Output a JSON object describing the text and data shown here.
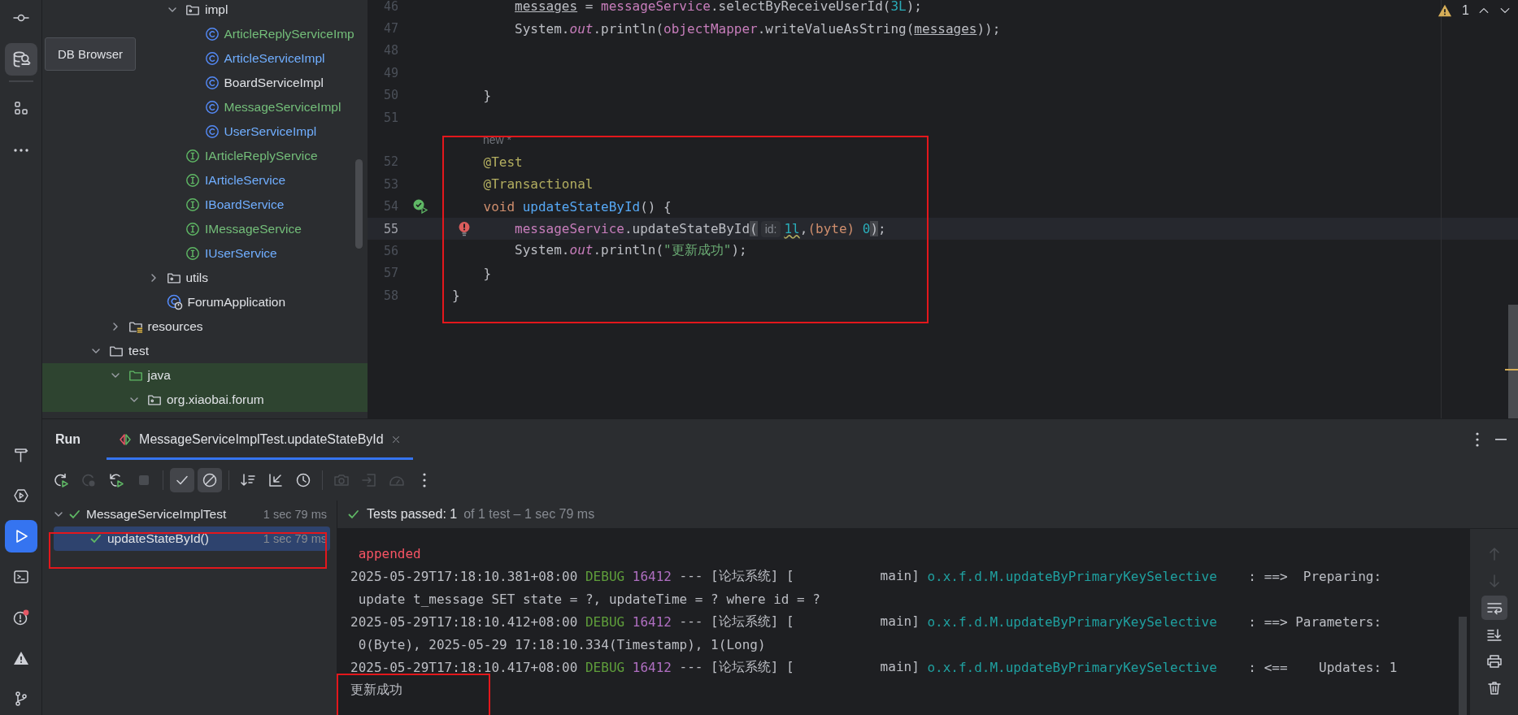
{
  "left_toolbar": {
    "top": [
      {
        "kind": "commit",
        "selected": false
      },
      {
        "kind": "database",
        "selected": true
      },
      {
        "kind": "structure",
        "selected": false
      },
      {
        "kind": "more",
        "selected": false
      }
    ],
    "bottom": [
      {
        "kind": "build",
        "selected": false
      },
      {
        "kind": "services",
        "selected": false
      },
      {
        "kind": "run",
        "selected": true
      },
      {
        "kind": "terminal",
        "selected": false
      },
      {
        "kind": "problems",
        "selected": false,
        "badge": true
      },
      {
        "kind": "warning",
        "selected": false
      },
      {
        "kind": "git",
        "selected": false
      }
    ]
  },
  "tooltip": {
    "text": "DB Browser"
  },
  "project_tree": {
    "items": [
      {
        "children": [
          {
            "children": [
              {
                "children": [
                  {
                    "children": [
                      {
                        "label": "impl",
                        "kind": "package",
                        "color": "#dfe1e5",
                        "expanded": true,
                        "highlighted": false,
                        "children": [
                          {
                            "label": "ArticleReplyServiceImp",
                            "kind": "class",
                            "color": "#73bd79",
                            "highlighted": false
                          },
                          {
                            "label": "ArticleServiceImpl",
                            "kind": "class",
                            "color": "#70aeff",
                            "highlighted": false
                          },
                          {
                            "label": "BoardServiceImpl",
                            "kind": "class",
                            "color": "#dfe1e5",
                            "highlighted": false
                          },
                          {
                            "label": "MessageServiceImpl",
                            "kind": "class",
                            "color": "#73bd79",
                            "highlighted": false
                          },
                          {
                            "label": "UserServiceImpl",
                            "kind": "class",
                            "color": "#70aeff",
                            "highlighted": false
                          }
                        ]
                      },
                      {
                        "label": "IArticleReplyService",
                        "kind": "interface",
                        "color": "#73bd79",
                        "highlighted": false
                      },
                      {
                        "label": "IArticleService",
                        "kind": "interface",
                        "color": "#70aeff",
                        "highlighted": false
                      },
                      {
                        "label": "IBoardService",
                        "kind": "interface",
                        "color": "#70aeff",
                        "highlighted": false
                      },
                      {
                        "label": "IMessageService",
                        "kind": "interface",
                        "color": "#73bd79",
                        "highlighted": false
                      },
                      {
                        "label": "IUserService",
                        "kind": "interface",
                        "color": "#70aeff",
                        "highlighted": false
                      }
                    ]
                  },
                  {
                    "label": "utils",
                    "kind": "package",
                    "color": "#dfe1e5",
                    "expanded": false,
                    "highlighted": false
                  },
                  {
                    "label": "ForumApplication",
                    "kind": "app",
                    "color": "#dfe1e5",
                    "highlighted": false
                  }
                ]
              }
            ]
          },
          {
            "label": "resources",
            "kind": "resources",
            "color": "#dfe1e5",
            "expanded": false,
            "highlighted": false
          }
        ]
      },
      {
        "label": "test",
        "kind": "folder",
        "color": "#dfe1e5",
        "expanded": true,
        "highlighted": false,
        "children": [
          {
            "label": "java",
            "kind": "test-root",
            "color": "#dfe1e5",
            "expanded": true,
            "highlighted": true,
            "children": [
              {
                "label": "org.xiaobai.forum",
                "kind": "package",
                "color": "#dfe1e5",
                "expanded": true,
                "highlighted": true
              }
            ]
          }
        ]
      }
    ]
  },
  "editor": {
    "problems": {
      "count": "1"
    },
    "lines": [
      {
        "kind": "code",
        "number": "46",
        "current": false,
        "tokens": [
          {
            "text": "        messages",
            "kind": "underlined"
          },
          {
            "text": " = ",
            "kind": "plain"
          },
          {
            "text": "messageService",
            "kind": "field"
          },
          {
            "text": ".selectByReceiveUserId(",
            "kind": "plain"
          },
          {
            "text": "3L",
            "kind": "number"
          },
          {
            "text": ");",
            "kind": "plain"
          }
        ]
      },
      {
        "kind": "code",
        "number": "47",
        "current": false,
        "tokens": [
          {
            "text": "        System.",
            "kind": "plain"
          },
          {
            "text": "out",
            "kind": "static"
          },
          {
            "text": ".println(",
            "kind": "plain"
          },
          {
            "text": "objectMapper",
            "kind": "field"
          },
          {
            "text": ".writeValueAsString(",
            "kind": "plain"
          },
          {
            "text": "messages",
            "kind": "underlined"
          },
          {
            "text": "));",
            "kind": "plain"
          }
        ]
      },
      {
        "kind": "code",
        "number": "48",
        "current": false
      },
      {
        "kind": "code",
        "number": "49",
        "current": false
      },
      {
        "kind": "code",
        "number": "50",
        "current": false,
        "tokens": [
          {
            "text": "    }",
            "kind": "plain"
          }
        ]
      },
      {
        "kind": "code",
        "number": "51",
        "current": false
      },
      {
        "kind": "hint",
        "text": "new *"
      },
      {
        "kind": "code",
        "number": "52",
        "current": false,
        "tokens": [
          {
            "text": "    @Test",
            "kind": "annotation"
          }
        ]
      },
      {
        "kind": "code",
        "number": "53",
        "current": false,
        "tokens": [
          {
            "text": "    @Transactional",
            "kind": "annotation"
          }
        ]
      },
      {
        "kind": "code",
        "number": "54",
        "current": false,
        "gutter": {
          "kind": "run-passed"
        },
        "tokens": [
          {
            "text": "    void ",
            "kind": "keyword"
          },
          {
            "text": "updateStateById",
            "kind": "declaration"
          },
          {
            "text": "() {",
            "kind": "plain"
          }
        ]
      },
      {
        "kind": "code",
        "number": "55",
        "current": true,
        "gutter": {
          "kind": "error"
        },
        "tokens": [
          {
            "text": "        messageService",
            "kind": "field"
          },
          {
            "text": ".updateStateById",
            "kind": "plain"
          },
          {
            "text": "(",
            "kind": "bracket"
          },
          {
            "text": "id:",
            "kind": "inlay"
          },
          {
            "text": "1l",
            "kind": "number-warning"
          },
          {
            "text": ",",
            "kind": "plain"
          },
          {
            "text": "(byte) ",
            "kind": "keyword"
          },
          {
            "text": "0",
            "kind": "number"
          },
          {
            "text": ")",
            "kind": "bracket"
          },
          {
            "text": ";",
            "kind": "plain"
          }
        ]
      },
      {
        "kind": "code",
        "number": "56",
        "current": false,
        "tokens": [
          {
            "text": "        System.",
            "kind": "plain"
          },
          {
            "text": "out",
            "kind": "static"
          },
          {
            "text": ".println(",
            "kind": "plain"
          },
          {
            "text": "\"更新成功\"",
            "kind": "string"
          },
          {
            "text": ");",
            "kind": "plain"
          }
        ]
      },
      {
        "kind": "code",
        "number": "57",
        "current": false,
        "tokens": [
          {
            "text": "    }",
            "kind": "plain"
          }
        ]
      },
      {
        "kind": "code",
        "number": "58",
        "current": false,
        "tokens": [
          {
            "text": "}",
            "kind": "plain"
          }
        ]
      }
    ]
  },
  "run": {
    "title": "Run",
    "tabs": [
      {
        "label": "MessageServiceImplTest.updateStateById",
        "selected": true
      }
    ],
    "toolbar": [
      {
        "kind": "rerun",
        "disabled": false
      },
      {
        "kind": "rerun-failed",
        "disabled": true
      },
      {
        "kind": "auto-rerun",
        "disabled": false
      },
      {
        "kind": "stop",
        "disabled": true
      },
      {
        "kind": "separator"
      },
      {
        "kind": "show-passed",
        "disabled": false,
        "on": true
      },
      {
        "kind": "show-ignored",
        "disabled": false,
        "on": true
      },
      {
        "kind": "separator"
      },
      {
        "kind": "sort",
        "disabled": false
      },
      {
        "kind": "collapse",
        "disabled": false
      },
      {
        "kind": "history",
        "disabled": false
      },
      {
        "kind": "separator"
      },
      {
        "kind": "camera",
        "disabled": true
      },
      {
        "kind": "import",
        "disabled": true
      },
      {
        "kind": "gauge",
        "disabled": true
      },
      {
        "kind": "more",
        "disabled": false
      }
    ],
    "tests": [
      {
        "label": "MessageServiceImplTest",
        "time": "1 sec 79 ms",
        "kind": "passed",
        "expanded": true,
        "selected": false,
        "children": [
          {
            "label": "updateStateById()",
            "time": "1 sec 79 ms",
            "kind": "passed",
            "selected": true
          }
        ]
      }
    ],
    "summary": {
      "label": "Tests passed: 1",
      "detail": "of 1 test – 1 sec 79 ms"
    },
    "console": [
      {
        "segments": [
          {
            "text": " appended",
            "kind": "error"
          }
        ]
      },
      {
        "segments": [
          {
            "text": "2025-05-29T17:18:10.381+08:00 ",
            "kind": "plain"
          },
          {
            "text": "DEBUG",
            "kind": "level"
          },
          {
            "text": " 16412",
            "kind": "pid"
          },
          {
            "text": " --- [论坛系统] [           main] ",
            "kind": "plain"
          },
          {
            "text": "o.x.f.d.M.updateByPrimaryKeySelective",
            "kind": "logger"
          },
          {
            "text": "    : ==>  Preparing:",
            "kind": "plain"
          }
        ]
      },
      {
        "segments": [
          {
            "text": " update t_message SET state = ?, updateTime = ? where id = ?",
            "kind": "plain"
          }
        ]
      },
      {
        "segments": [
          {
            "text": "2025-05-29T17:18:10.412+08:00 ",
            "kind": "plain"
          },
          {
            "text": "DEBUG",
            "kind": "level"
          },
          {
            "text": " 16412",
            "kind": "pid"
          },
          {
            "text": " --- [论坛系统] [           main] ",
            "kind": "plain"
          },
          {
            "text": "o.x.f.d.M.updateByPrimaryKeySelective",
            "kind": "logger"
          },
          {
            "text": "    : ==> Parameters:",
            "kind": "plain"
          }
        ]
      },
      {
        "segments": [
          {
            "text": " 0(Byte), 2025-05-29 17:18:10.334(Timestamp), 1(Long)",
            "kind": "plain"
          }
        ]
      },
      {
        "segments": [
          {
            "text": "2025-05-29T17:18:10.417+08:00 ",
            "kind": "plain"
          },
          {
            "text": "DEBUG",
            "kind": "level"
          },
          {
            "text": " 16412",
            "kind": "pid"
          },
          {
            "text": " --- [论坛系统] [           main] ",
            "kind": "plain"
          },
          {
            "text": "o.x.f.d.M.updateByPrimaryKeySelective",
            "kind": "logger"
          },
          {
            "text": "    : <==    Updates: 1",
            "kind": "plain"
          }
        ]
      },
      {
        "segments": [
          {
            "text": "更新成功",
            "kind": "plain"
          }
        ]
      }
    ],
    "console_toolbar": [
      {
        "kind": "up",
        "disabled": true
      },
      {
        "kind": "down",
        "disabled": true
      },
      {
        "kind": "soft-wrap",
        "disabled": false,
        "on": true
      },
      {
        "kind": "scroll-end",
        "disabled": false
      },
      {
        "kind": "print",
        "disabled": false
      },
      {
        "kind": "clear",
        "disabled": false
      }
    ]
  }
}
